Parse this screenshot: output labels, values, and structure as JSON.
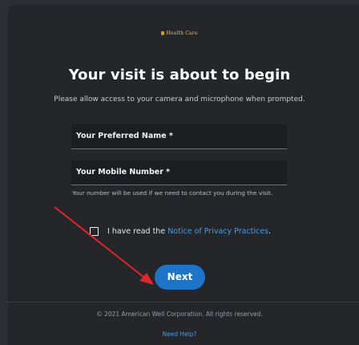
{
  "brand": {
    "logo_text": "Health Care",
    "logo_icon": "shield-icon"
  },
  "heading": "Your visit is about to begin",
  "subtitle": "Please allow access to your camera and microphone when prompted.",
  "fields": {
    "name_label": "Your Preferred Name *",
    "mobile_label": "Your Mobile Number *",
    "mobile_hint": "Your number will be used if we need to contact you during the visit."
  },
  "consent": {
    "checked": false,
    "prefix": "I have read the ",
    "link_text": "Notice of Privacy Practices",
    "suffix": "."
  },
  "next_label": "Next",
  "footer": {
    "copyright": "© 2021 American Well Corporation. All rights reserved.",
    "help_link": "Need Help?"
  },
  "colors": {
    "background": "#24262a",
    "primary_button": "#1e74c8",
    "link": "#4a9be8",
    "annotation_arrow": "#e0262b"
  }
}
